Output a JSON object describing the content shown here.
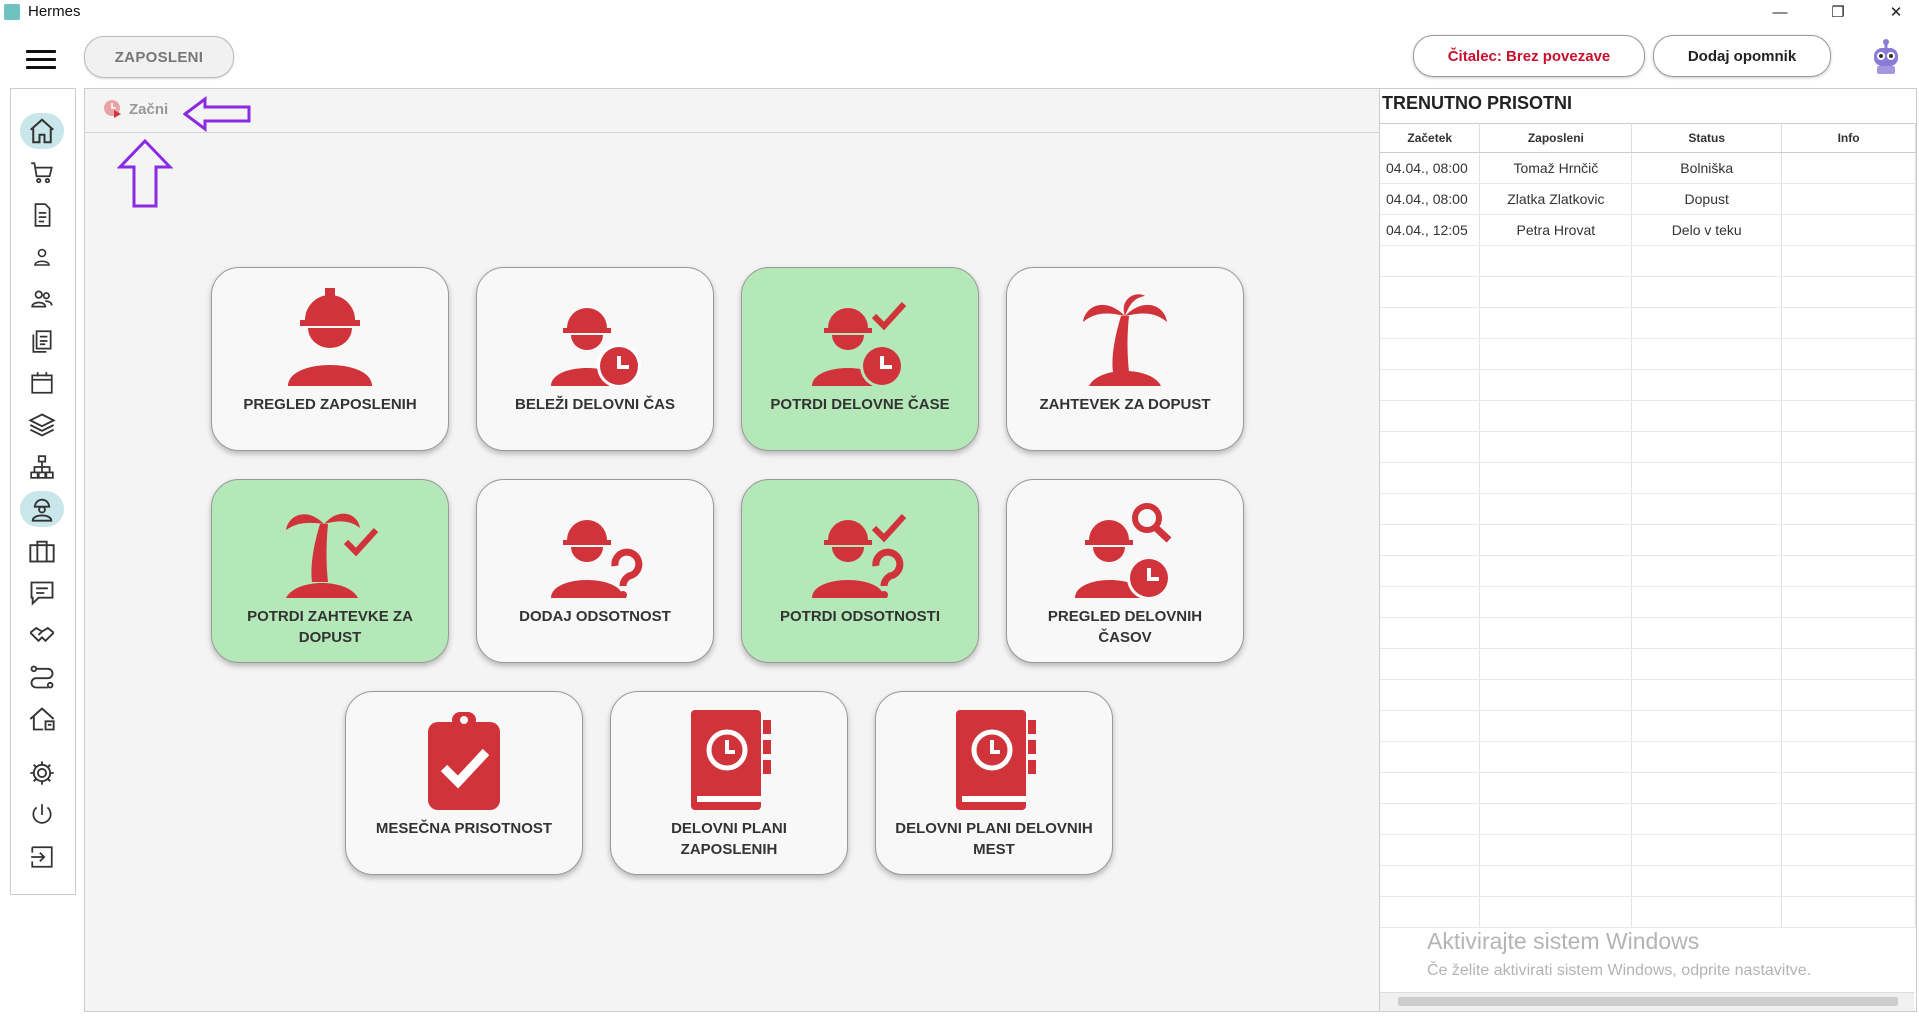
{
  "window": {
    "title": "Hermes",
    "controls": [
      "—",
      "❐",
      "✕"
    ]
  },
  "header": {
    "module_label": "ZAPOSLENI",
    "reader_button": "Čitalec: Brez povezave",
    "reminder_button": "Dodaj opomnik",
    "colors": {
      "reader_text": "#c8102e",
      "accent_red": "#d0333a",
      "green_tile": "#b5e8b8",
      "active_side": "#c9e7ea",
      "annotation_purple": "#8a2be2"
    }
  },
  "sidebar": {
    "items": [
      {
        "icon": "home-icon"
      },
      {
        "icon": "cart-icon"
      },
      {
        "icon": "document-icon"
      },
      {
        "icon": "person-icon"
      },
      {
        "icon": "people-icon"
      },
      {
        "icon": "documents-icon"
      },
      {
        "icon": "calendar-icon"
      },
      {
        "icon": "layers-icon"
      },
      {
        "icon": "sitemap-icon"
      },
      {
        "icon": "worker-icon"
      },
      {
        "icon": "briefcase-icon"
      },
      {
        "icon": "chat-icon"
      },
      {
        "icon": "handshake-icon"
      },
      {
        "icon": "route-icon"
      },
      {
        "icon": "house-icon"
      },
      {
        "icon": "settings-icon"
      },
      {
        "icon": "power-icon"
      },
      {
        "icon": "logout-icon"
      }
    ],
    "active_index": 9
  },
  "main": {
    "breadcrumb": "Začni",
    "tiles": [
      {
        "label": "PREGLED ZAPOSLENIH",
        "icon": "worker-icon",
        "green": false
      },
      {
        "label": "BELEŽI DELOVNI ČAS",
        "icon": "worker-clock-icon",
        "green": false
      },
      {
        "label": "POTRDI DELOVNE ČASE",
        "icon": "worker-clock-check-icon",
        "green": true
      },
      {
        "label": "ZAHTEVEK ZA DOPUST",
        "icon": "palm-island-icon",
        "green": false
      },
      {
        "label": "POTRDI ZAHTEVKE ZA DOPUST",
        "icon": "palm-island-check-icon",
        "green": true
      },
      {
        "label": "DODAJ ODSOTNOST",
        "icon": "worker-question-icon",
        "green": false
      },
      {
        "label": "POTRDI ODSOTNOSTI",
        "icon": "worker-question-check-icon",
        "green": true
      },
      {
        "label": "PREGLED DELOVNIH ČASOV",
        "icon": "worker-search-clock-icon",
        "green": false
      },
      {
        "label": "MESEČNA PRISOTNOST",
        "icon": "clipboard-check-icon",
        "green": false
      },
      {
        "label": "DELOVNI PLANI ZAPOSLENIH",
        "icon": "book-clock-icon",
        "green": false
      },
      {
        "label": "DELOVNI PLANI DELOVNIH MEST",
        "icon": "book-clock-icon",
        "green": false
      }
    ]
  },
  "presence": {
    "title": "TRENUTNO PRISOTNI",
    "columns": [
      "Začetek",
      "Zaposleni",
      "Status",
      "Info"
    ],
    "rows": [
      [
        "04.04., 08:00",
        "Tomaž Hrnčič",
        "Bolniška",
        ""
      ],
      [
        "04.04., 08:00",
        "Zlatka Zlatkovic",
        "Dopust",
        ""
      ],
      [
        "04.04., 12:05",
        "Petra Hrovat",
        "Delo v teku",
        ""
      ]
    ]
  },
  "watermark": {
    "line1": "Aktivirajte sistem Windows",
    "line2": "Če želite aktivirati sistem Windows, odprite nastavitve."
  }
}
